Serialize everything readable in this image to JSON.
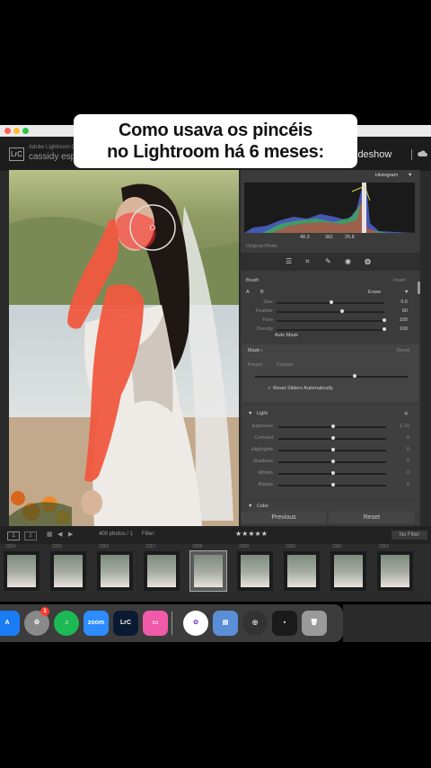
{
  "caption": {
    "line1": "Como usava os pincéis",
    "line2": "no Lightroom há 6 meses:"
  },
  "idplate": {
    "badge": "LrC",
    "app_name": "Adobe Lightroom Cl",
    "user": "cassidy espin",
    "module": "ideshow"
  },
  "histogram": {
    "title": "Histogram",
    "readout_a": "48.3",
    "readout_b": "381",
    "readout_c": "25.8",
    "original_photo": "Original Photo"
  },
  "brush": {
    "title": "Brush",
    "invert": "Invert",
    "a": "A",
    "b": "B",
    "erase": "Erase",
    "sliders": [
      {
        "label": "Size",
        "value": "0.0",
        "pos": 0.5
      },
      {
        "label": "Feather",
        "value": "60",
        "pos": 0.6
      },
      {
        "label": "Flow",
        "value": "100",
        "pos": 1.0
      },
      {
        "label": "Density",
        "value": "100",
        "pos": 1.0
      }
    ],
    "automask": "Auto Mask"
  },
  "mask": {
    "title": "Mask ›",
    "reset": "Reset",
    "preset_label": "Preset",
    "preset_value": "Custom",
    "amount": 0.65,
    "reset_sliders": "Reset Sliders Automatically"
  },
  "light": {
    "title": "Light",
    "sliders": [
      {
        "label": "Exposure",
        "value": "2.10",
        "pos": 0.5
      },
      {
        "label": "Contrast",
        "value": "0",
        "pos": 0.5
      },
      {
        "label": "Highlights",
        "value": "0",
        "pos": 0.5
      },
      {
        "label": "Shadows",
        "value": "0",
        "pos": 0.5
      },
      {
        "label": "Whites",
        "value": "0",
        "pos": 0.5
      },
      {
        "label": "Blacks",
        "value": "0",
        "pos": 0.5
      }
    ]
  },
  "color_section": "Color",
  "buttons": {
    "previous": "Previous",
    "reset": "Reset"
  },
  "filmbar": {
    "page1": "1",
    "page2": "2",
    "photos": "400 photos / 1",
    "filter": "Filter:",
    "rating": "★★★★★",
    "no_filter": "No Filter"
  },
  "thumbnails": [
    "2354",
    "2355",
    "2356",
    "2357",
    "2358",
    "2359",
    "2360",
    "2361",
    "2362"
  ],
  "dock": [
    {
      "name": "app-store",
      "label": "A",
      "color": "#1a7cf5"
    },
    {
      "name": "settings",
      "label": "⚙",
      "color": "#8a8a8a",
      "badge": "1"
    },
    {
      "name": "spotify",
      "label": "♫",
      "color": "#1db954"
    },
    {
      "name": "zoom",
      "label": "zoom",
      "color": "#2d8cff"
    },
    {
      "name": "lightroom-classic",
      "label": "LrC",
      "color": "#0b1a33"
    },
    {
      "name": "cleanup",
      "label": "▭",
      "color": "#f05aa8"
    },
    {
      "name": "photos",
      "label": "✿",
      "color": "#ffffff"
    },
    {
      "name": "preview",
      "label": "▤",
      "color": "#5a8fd8"
    },
    {
      "name": "quicktime",
      "label": "◎",
      "color": "#333333"
    },
    {
      "name": "screen-app",
      "label": "▪",
      "color": "#1a1a1a"
    },
    {
      "name": "trash",
      "label": "🗑",
      "color": "#9a9a9a"
    }
  ]
}
